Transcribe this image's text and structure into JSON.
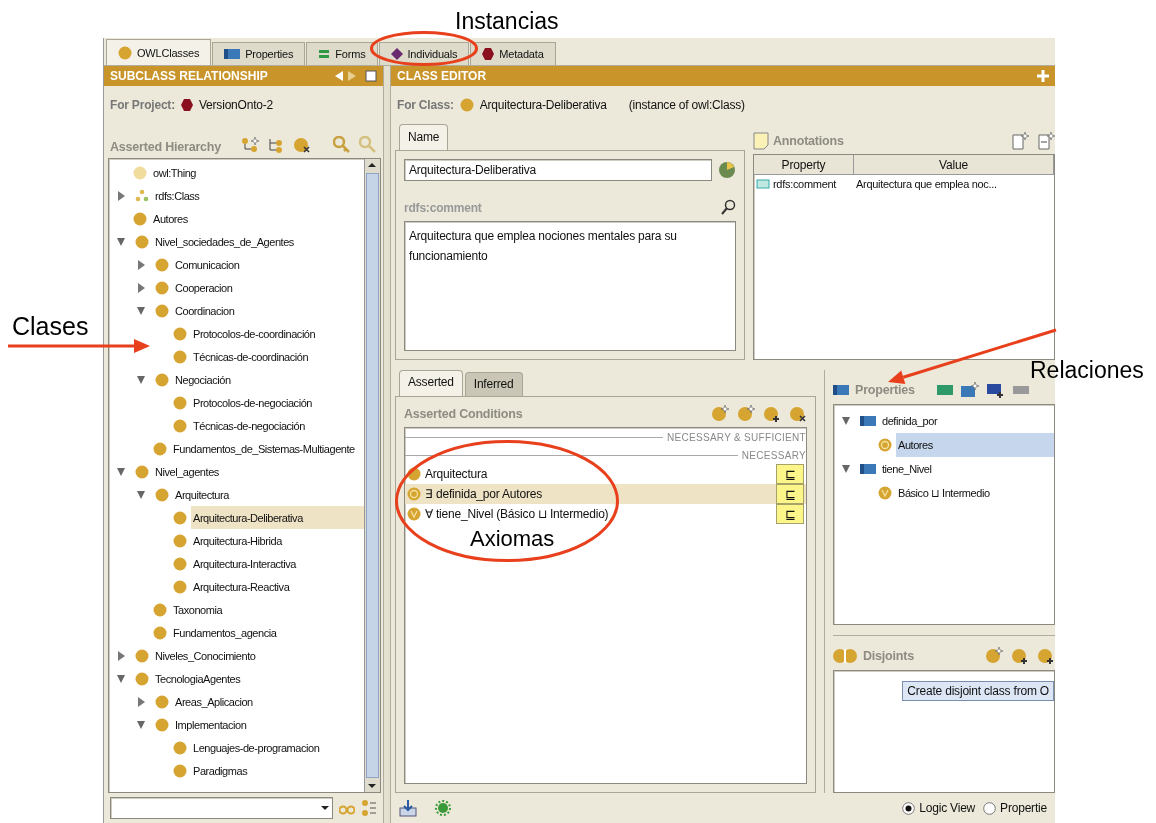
{
  "callouts": [
    {
      "kind": "ellipse",
      "text": "Instancias"
    },
    {
      "kind": "arrow",
      "text": "Clases"
    },
    {
      "kind": "arrow",
      "text": "Relaciones"
    },
    {
      "kind": "ellipse",
      "text": "Axiomas"
    }
  ],
  "tabs": [
    {
      "label": "OWLClasses",
      "kind": "class",
      "selected": true
    },
    {
      "label": "Properties",
      "kind": "property",
      "selected": false
    },
    {
      "label": "Forms",
      "kind": "form",
      "selected": false
    },
    {
      "label": "Individuals",
      "kind": "individual",
      "selected": false
    },
    {
      "label": "Metadata",
      "kind": "metadata",
      "selected": false
    }
  ],
  "class_browser": {
    "title": "SUBCLASS RELATIONSHIP",
    "project_label": "For Project:",
    "project": "VersionOnto-2",
    "hierarchy_title": "Asserted Hierarchy",
    "tree": [
      {
        "label": "owl:Thing",
        "kind": "thing",
        "selected": false
      },
      {
        "label": "rdfs:Class",
        "kind": "metaclass",
        "expanded": false,
        "selected": false
      },
      {
        "label": "Autores",
        "kind": "class",
        "selected": false
      },
      {
        "label": "Nivel_sociedades_de_Agentes",
        "kind": "class",
        "expanded": true,
        "selected": false,
        "children": [
          {
            "label": "Comunicacion",
            "kind": "class",
            "expanded": false,
            "selected": false
          },
          {
            "label": "Cooperacion",
            "kind": "class",
            "expanded": false,
            "selected": false
          },
          {
            "label": "Coordinacion",
            "kind": "class",
            "expanded": true,
            "selected": false,
            "children": [
              {
                "label": "Protocolos-de-coordinación",
                "kind": "class",
                "selected": false
              },
              {
                "label": "Técnicas-de-coordinación",
                "kind": "class",
                "selected": false
              }
            ]
          },
          {
            "label": "Negociación",
            "kind": "class",
            "expanded": true,
            "selected": false,
            "children": [
              {
                "label": "Protocolos-de-negociación",
                "kind": "class",
                "selected": false
              },
              {
                "label": "Técnicas-de-negociación",
                "kind": "class",
                "selected": false
              }
            ]
          },
          {
            "label": "Fundamentos_de_Sistemas-Multiagente",
            "kind": "class",
            "selected": false
          }
        ]
      },
      {
        "label": "Nivel_agentes",
        "kind": "class",
        "expanded": true,
        "selected": false,
        "children": [
          {
            "label": "Arquitectura",
            "kind": "class",
            "expanded": true,
            "selected": false,
            "children": [
              {
                "label": "Arquitectura-Deliberativa",
                "kind": "class",
                "selected": true
              },
              {
                "label": "Arquitectura-Hibrida",
                "kind": "class",
                "selected": false
              },
              {
                "label": "Arquitectura-Interactiva",
                "kind": "class",
                "selected": false
              },
              {
                "label": "Arquitectura-Reactiva",
                "kind": "class",
                "selected": false
              }
            ]
          },
          {
            "label": "Taxonomia",
            "kind": "class",
            "selected": false
          },
          {
            "label": "Fundamentos_agencia",
            "kind": "class",
            "selected": false
          }
        ]
      },
      {
        "label": "Niveles_Conocimiento",
        "kind": "class",
        "expanded": false,
        "selected": false
      },
      {
        "label": "TecnologiaAgentes",
        "kind": "class",
        "expanded": true,
        "selected": false,
        "children": [
          {
            "label": "Areas_Aplicacion",
            "kind": "class",
            "expanded": false,
            "selected": false
          },
          {
            "label": "Implementacion",
            "kind": "class",
            "expanded": true,
            "selected": false,
            "children": [
              {
                "label": "Lenguajes-de-programacion",
                "kind": "class",
                "selected": false
              },
              {
                "label": "Paradigmas",
                "kind": "class",
                "selected": false
              }
            ]
          }
        ]
      }
    ]
  },
  "class_editor": {
    "title": "CLASS EDITOR",
    "for_class_label": "For Class:",
    "class_name": "Arquitectura-Deliberativa",
    "instance_of": "(instance of owl:Class)",
    "name_tab": "Name",
    "name_value": "Arquitectura-Deliberativa",
    "comment_label": "rdfs:comment",
    "comment": "Arquitectura que emplea nociones mentales para su funcionamiento",
    "annotations": {
      "title": "Annotations",
      "columns": [
        "Property",
        "Value"
      ],
      "rows": [
        [
          "rdfs:comment",
          "Arquitectura que emplea noc..."
        ]
      ]
    },
    "condition_tabs": [
      {
        "label": "Asserted",
        "selected": true
      },
      {
        "label": "Inferred",
        "selected": false
      }
    ],
    "conditions": {
      "title": "Asserted Conditions",
      "sections": [
        "NECESSARY & SUFFICIENT",
        "NECESSARY"
      ],
      "rows": [
        {
          "kind": "named",
          "text": "Arquitectura",
          "symbol": "⊑",
          "selected": false
        },
        {
          "kind": "some",
          "text": "∃ definida_por Autores",
          "symbol": "⊑",
          "selected": true
        },
        {
          "kind": "all",
          "text": "∀ tiene_Nivel (Básico ⊔ Intermedio)",
          "symbol": "⊑",
          "selected": false
        }
      ]
    },
    "properties": {
      "title": "Properties",
      "tree": [
        {
          "label": "definida_por",
          "kind": "property",
          "expanded": true,
          "selected": false,
          "children": [
            {
              "label": "Autores",
              "kind": "some",
              "selected": true
            }
          ]
        },
        {
          "label": "tiene_Nivel",
          "kind": "property",
          "expanded": true,
          "selected": false,
          "children": [
            {
              "label": "Básico ⊔ Intermedio",
              "kind": "all",
              "selected": false
            }
          ]
        }
      ]
    },
    "disjoints": {
      "title": "Disjoints",
      "hint": "Create disjoint class from O"
    },
    "view_options": [
      {
        "label": "Logic View",
        "selected": true
      },
      {
        "label": "Propertie",
        "selected": false
      }
    ]
  }
}
